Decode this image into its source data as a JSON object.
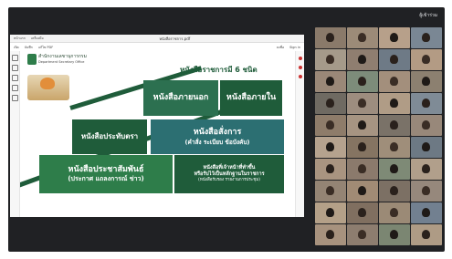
{
  "meet": {
    "top_label": "ผู้เข้าร่วม"
  },
  "pdf": {
    "menu": [
      "หน้าแรก",
      "เครื่องมือ",
      "หนังสือราชการ.pdf"
    ],
    "toolbar": [
      "เปิด",
      "บันทึก",
      "แก้ไข PDF",
      "ลงชื่อ",
      "Sign in"
    ],
    "slide": {
      "org_name": "สำนักงานเลขานุการกรม",
      "org_sub": "Department Secretary Office",
      "title": "หนังสือราชการมี 6 ชนิด",
      "boxes": {
        "external": "หนังสือภายนอก",
        "internal": "หนังสือภายใน",
        "stamp": "หนังสือประทับตรา",
        "order_title": "หนังสือสั่งการ",
        "order_sub": "(คำสั่ง ระเบียบ ข้อบังคับ)",
        "pr_title": "หนังสือประชาสัมพันธ์",
        "pr_sub": "(ประกาศ แถลงการณ์ ข่าว)",
        "evidence_title": "หนังสือที่เจ้าหน้าที่ทำขึ้น",
        "evidence_line2": "หรือรับไว้เป็นหลักฐานในราชการ",
        "evidence_sub": "(หนังสือรับรอง รายงานการประชุม)"
      }
    }
  },
  "participants": {
    "colors": [
      "#8a7a6a",
      "#9c8b78",
      "#b7a08a",
      "#7a8794",
      "#a59a8a",
      "#8f7e70",
      "#6e7a86",
      "#b39b84",
      "#9a8878",
      "#7d8c7a",
      "#a38f7c",
      "#8c8070",
      "#6f6a62",
      "#9d8d7f",
      "#b09c86",
      "#7f8b96",
      "#8e7c6a",
      "#a69482",
      "#7a7268",
      "#98887a",
      "#b5a28e",
      "#857462",
      "#9f8e7a",
      "#6d7984",
      "#a99480",
      "#8b7a6c",
      "#7e8a76",
      "#b19f8b",
      "#948474",
      "#a18b75",
      "#7c7064",
      "#96887c",
      "#b4a088",
      "#806f60",
      "#9b8a76",
      "#728090",
      "#a7927e",
      "#8d7d6f",
      "#7b8672",
      "#ae9b85"
    ],
    "name_tag": "ผู้เข้าร่วม"
  }
}
